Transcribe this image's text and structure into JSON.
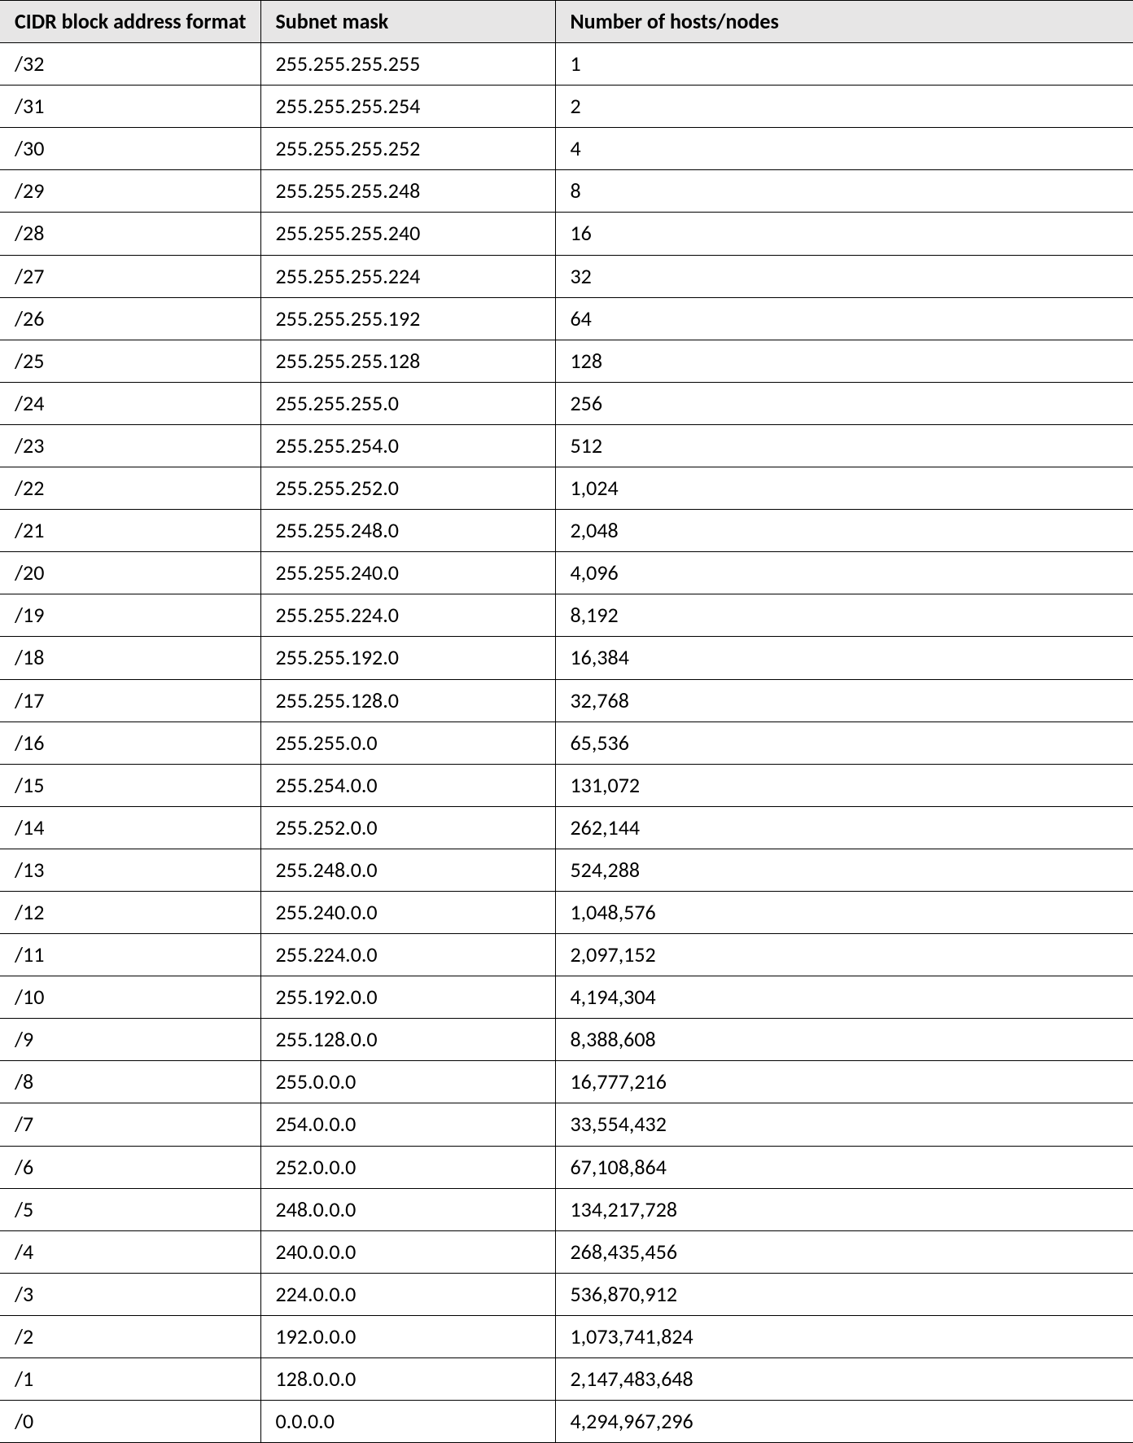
{
  "headers": {
    "cidr": "CIDR block address format",
    "mask": "Subnet mask",
    "hosts": "Number of hosts/nodes"
  },
  "rows": [
    {
      "cidr": "/32",
      "mask": "255.255.255.255",
      "hosts": "1"
    },
    {
      "cidr": "/31",
      "mask": "255.255.255.254",
      "hosts": "2"
    },
    {
      "cidr": "/30",
      "mask": "255.255.255.252",
      "hosts": "4"
    },
    {
      "cidr": "/29",
      "mask": "255.255.255.248",
      "hosts": "8"
    },
    {
      "cidr": "/28",
      "mask": "255.255.255.240",
      "hosts": "16"
    },
    {
      "cidr": "/27",
      "mask": "255.255.255.224",
      "hosts": "32"
    },
    {
      "cidr": "/26",
      "mask": "255.255.255.192",
      "hosts": "64"
    },
    {
      "cidr": "/25",
      "mask": "255.255.255.128",
      "hosts": "128"
    },
    {
      "cidr": "/24",
      "mask": "255.255.255.0",
      "hosts": "256"
    },
    {
      "cidr": "/23",
      "mask": "255.255.254.0",
      "hosts": "512"
    },
    {
      "cidr": "/22",
      "mask": "255.255.252.0",
      "hosts": "1,024"
    },
    {
      "cidr": "/21",
      "mask": "255.255.248.0",
      "hosts": "2,048"
    },
    {
      "cidr": "/20",
      "mask": "255.255.240.0",
      "hosts": "4,096"
    },
    {
      "cidr": "/19",
      "mask": "255.255.224.0",
      "hosts": "8,192"
    },
    {
      "cidr": "/18",
      "mask": "255.255.192.0",
      "hosts": "16,384"
    },
    {
      "cidr": "/17",
      "mask": "255.255.128.0",
      "hosts": "32,768"
    },
    {
      "cidr": "/16",
      "mask": "255.255.0.0",
      "hosts": "65,536"
    },
    {
      "cidr": "/15",
      "mask": "255.254.0.0",
      "hosts": "131,072"
    },
    {
      "cidr": "/14",
      "mask": "255.252.0.0",
      "hosts": "262,144"
    },
    {
      "cidr": "/13",
      "mask": "255.248.0.0",
      "hosts": "524,288"
    },
    {
      "cidr": "/12",
      "mask": "255.240.0.0",
      "hosts": "1,048,576"
    },
    {
      "cidr": "/11",
      "mask": "255.224.0.0",
      "hosts": "2,097,152"
    },
    {
      "cidr": "/10",
      "mask": "255.192.0.0",
      "hosts": "4,194,304"
    },
    {
      "cidr": "/9",
      "mask": "255.128.0.0",
      "hosts": "8,388,608"
    },
    {
      "cidr": "/8",
      "mask": "255.0.0.0",
      "hosts": "16,777,216"
    },
    {
      "cidr": "/7",
      "mask": "254.0.0.0",
      "hosts": "33,554,432"
    },
    {
      "cidr": "/6",
      "mask": "252.0.0.0",
      "hosts": "67,108,864"
    },
    {
      "cidr": "/5",
      "mask": "248.0.0.0",
      "hosts": "134,217,728"
    },
    {
      "cidr": "/4",
      "mask": "240.0.0.0",
      "hosts": "268,435,456"
    },
    {
      "cidr": "/3",
      "mask": "224.0.0.0",
      "hosts": "536,870,912"
    },
    {
      "cidr": "/2",
      "mask": "192.0.0.0",
      "hosts": "1,073,741,824"
    },
    {
      "cidr": "/1",
      "mask": "128.0.0.0",
      "hosts": "2,147,483,648"
    },
    {
      "cidr": "/0",
      "mask": "0.0.0.0",
      "hosts": "4,294,967,296"
    }
  ]
}
